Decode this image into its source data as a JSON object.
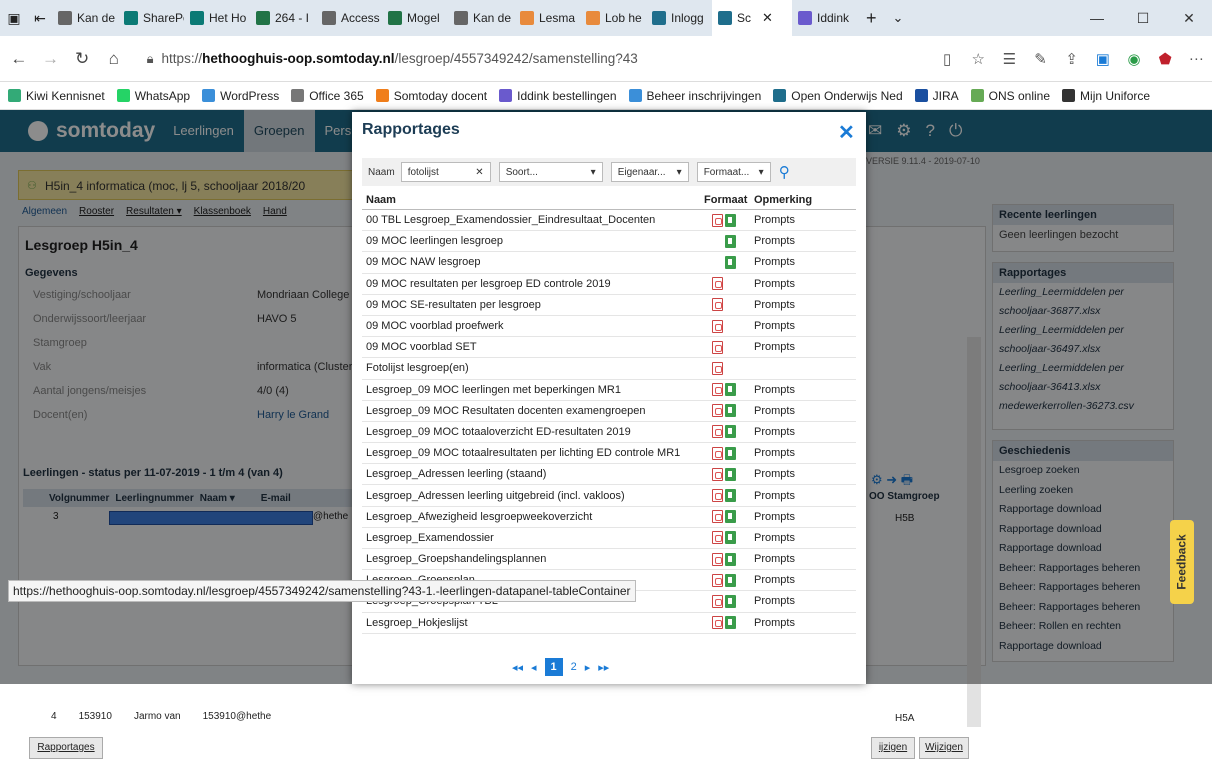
{
  "browser": {
    "tabs": [
      {
        "label": "Kan de",
        "color": "#666"
      },
      {
        "label": "SharePoint",
        "color": "#0b7a75"
      },
      {
        "label": "Het Ho",
        "color": "#0b7a75"
      },
      {
        "label": "264 - I",
        "color": "#217346"
      },
      {
        "label": "Access",
        "color": "#666"
      },
      {
        "label": "Mogel",
        "color": "#217346"
      },
      {
        "label": "Kan de",
        "color": "#666"
      },
      {
        "label": "Lesma",
        "color": "#e88a3c"
      },
      {
        "label": "Lob he",
        "color": "#e88a3c"
      },
      {
        "label": "Inlogg",
        "color": "#1f6e8c"
      },
      {
        "label": "Sc",
        "color": "#1f6e8c"
      },
      {
        "label": "Iddink",
        "color": "#6a5acd"
      }
    ],
    "url_prefix": "https://",
    "url_host": "hethooghuis-oop.somtoday.nl",
    "url_path": "/lesgroep/4557349242/samenstelling?43",
    "favorites": [
      "Kiwi Kennisnet",
      "WhatsApp",
      "WordPress",
      "Office 365",
      "Somtoday docent",
      "Iddink bestellingen",
      "Beheer inschrijvingen",
      "Open Onderwijs Ned",
      "JIRA",
      "ONS online",
      "Mijn Uniforce"
    ]
  },
  "app": {
    "brand": "somtoday",
    "nav": [
      "Leerlingen",
      "Groepen",
      "Pers"
    ],
    "version": "VERSIE 9.11.4 - 2019-07-10",
    "group_title": "H5in_4 informatica (moc, lj 5, schooljaar 2018/20",
    "subtabs": [
      "Algemeen",
      "Rooster",
      "Resultaten ▾",
      "Klassenboek",
      "Hand"
    ],
    "section_title": "Lesgroep H5in_4",
    "gegevens_label": "Gegevens",
    "fields": [
      {
        "label": "Vestiging/schooljaar",
        "value": "Mondriaan College"
      },
      {
        "label": "Onderwijssoort/leerjaar",
        "value": "HAVO 5"
      },
      {
        "label": "Stamgroep",
        "value": ""
      },
      {
        "label": "Vak",
        "value": "informatica (Cluster"
      },
      {
        "label": "Aantal jongens/meisjes",
        "value": "4/0 (4)"
      },
      {
        "label": "Docent(en)",
        "value": "Harry le Grand"
      }
    ],
    "students_title": "Leerlingen - status per 11-07-2019 - 1 t/m 4 (van 4)",
    "student_cols": [
      "Volgnummer",
      "Leerlingnummer",
      "Naam ▾",
      "E-mail"
    ],
    "row3": "3",
    "row3_email": "@hethe",
    "row3_stam": "H5B",
    "row4": [
      "4",
      "153910",
      "Jarmo van",
      "153910@hethe"
    ],
    "row4_stam": "H5A",
    "stam_col": "OO  Stamgroep",
    "rapportages_btn": "Rapportages",
    "wijzigen1": "ijzigen",
    "wijzigen2": "Wijzigen",
    "recent_title": "Recente leerlingen",
    "recent_text": "Geen leerlingen bezocht",
    "rapp_title": "Rapportages",
    "rapp_items": [
      "Leerling_Leermiddelen per",
      "schooljaar-36877.xlsx",
      "Leerling_Leermiddelen per",
      "schooljaar-36497.xlsx",
      "Leerling_Leermiddelen per",
      "schooljaar-36413.xlsx",
      "medewerkerrollen-36273.csv"
    ],
    "hist_title": "Geschiedenis",
    "hist_items": [
      "Lesgroep zoeken",
      "Leerling zoeken",
      "Rapportage download",
      "Rapportage download",
      "Rapportage download",
      "Beheer: Rapportages beheren",
      "Beheer: Rapportages beheren",
      "Beheer: Rapportages beheren",
      "Beheer: Rollen en rechten",
      "Rapportage download"
    ]
  },
  "modal": {
    "title": "Rapportages",
    "filter_label": "Naam",
    "filter_value": "fotolijst",
    "soort": "Soort...",
    "eigenaar": "Eigenaar...",
    "formaat": "Formaat...",
    "col_naam": "Naam",
    "col_formaat": "Formaat",
    "col_opmerking": "Opmerking",
    "rows": [
      {
        "name": "00 TBL Lesgroep_Examendossier_Eindresultaat_Docenten",
        "pdf": true,
        "xls": true,
        "note": "Prompts"
      },
      {
        "name": "09 MOC leerlingen lesgroep",
        "pdf": false,
        "xls": true,
        "note": "Prompts"
      },
      {
        "name": "09 MOC NAW lesgroep",
        "pdf": false,
        "xls": true,
        "note": "Prompts"
      },
      {
        "name": "09 MOC resultaten per lesgroep ED controle 2019",
        "pdf": true,
        "xls": false,
        "note": "Prompts"
      },
      {
        "name": "09 MOC SE-resultaten per lesgroep",
        "pdf": true,
        "xls": false,
        "note": "Prompts"
      },
      {
        "name": "09 MOC voorblad proefwerk",
        "pdf": true,
        "xls": false,
        "note": "Prompts"
      },
      {
        "name": "09 MOC voorblad SET",
        "pdf": true,
        "xls": false,
        "note": "Prompts"
      },
      {
        "name": "Fotolijst lesgroep(en)",
        "pdf": true,
        "xls": false,
        "note": ""
      },
      {
        "name": "Lesgroep_09 MOC leerlingen met beperkingen MR1",
        "pdf": true,
        "xls": true,
        "note": "Prompts"
      },
      {
        "name": "Lesgroep_09 MOC Resultaten docenten examengroepen",
        "pdf": true,
        "xls": true,
        "note": "Prompts"
      },
      {
        "name": "Lesgroep_09 MOC totaaloverzicht ED-resultaten 2019",
        "pdf": true,
        "xls": true,
        "note": "Prompts"
      },
      {
        "name": "Lesgroep_09 MOC totaalresultaten per lichting ED controle MR1",
        "pdf": true,
        "xls": true,
        "note": "Prompts"
      },
      {
        "name": "Lesgroep_Adressen leerling (staand)",
        "pdf": true,
        "xls": true,
        "note": "Prompts"
      },
      {
        "name": "Lesgroep_Adressen leerling uitgebreid (incl. vakloos)",
        "pdf": true,
        "xls": true,
        "note": "Prompts"
      },
      {
        "name": "Lesgroep_Afwezigheid lesgroepweekoverzicht",
        "pdf": true,
        "xls": true,
        "note": "Prompts"
      },
      {
        "name": "Lesgroep_Examendossier",
        "pdf": true,
        "xls": true,
        "note": "Prompts"
      },
      {
        "name": "Lesgroep_Groepshandelingsplannen",
        "pdf": true,
        "xls": true,
        "note": "Prompts"
      },
      {
        "name": "Lesgroep_Groepsplan",
        "pdf": true,
        "xls": true,
        "note": "Prompts"
      },
      {
        "name": "Lesgroep_Groepsplan TBL",
        "pdf": true,
        "xls": true,
        "note": "Prompts"
      },
      {
        "name": "Lesgroep_Hokjeslijst",
        "pdf": true,
        "xls": true,
        "note": "Prompts"
      }
    ],
    "pager": {
      "first": "◂◂",
      "prev": "◂",
      "current": "1",
      "next_page": "2",
      "next": "▸",
      "last": "▸▸"
    }
  },
  "status_url": "https://hethooghuis-oop.somtoday.nl/lesgroep/4557349242/samenstelling?43-1.-leerlingen-datapanel-tableContainer",
  "feedback": "Feedback"
}
